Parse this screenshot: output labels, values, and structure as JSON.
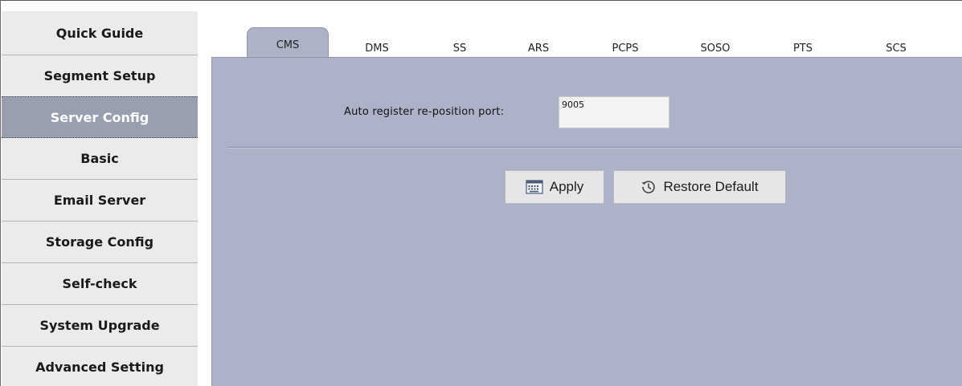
{
  "sidebar": {
    "items": [
      {
        "label": "Quick Guide",
        "active": false
      },
      {
        "label": "Segment Setup",
        "active": false
      },
      {
        "label": "Server Config",
        "active": true
      },
      {
        "label": "Basic",
        "active": false
      },
      {
        "label": "Email Server",
        "active": false
      },
      {
        "label": "Storage Config",
        "active": false
      },
      {
        "label": "Self-check",
        "active": false
      },
      {
        "label": "System Upgrade",
        "active": false
      },
      {
        "label": "Advanced Setting",
        "active": false
      }
    ]
  },
  "tabs": [
    {
      "label": "CMS",
      "active": true
    },
    {
      "label": "DMS",
      "active": false
    },
    {
      "label": "SS",
      "active": false
    },
    {
      "label": "ARS",
      "active": false
    },
    {
      "label": "PCPS",
      "active": false
    },
    {
      "label": "SOSO",
      "active": false
    },
    {
      "label": "PTS",
      "active": false
    },
    {
      "label": "SCS",
      "active": false
    }
  ],
  "form": {
    "port_label": "Auto register re-position port:",
    "port_value": "9005"
  },
  "buttons": {
    "apply_label": "Apply",
    "apply_icon": "keyboard-icon",
    "restore_label": "Restore Default",
    "restore_icon": "history-icon"
  },
  "colors": {
    "panel": "#aeb2c8",
    "active_nav": "#9a9fb0",
    "sidebar": "#e9e9ea"
  }
}
